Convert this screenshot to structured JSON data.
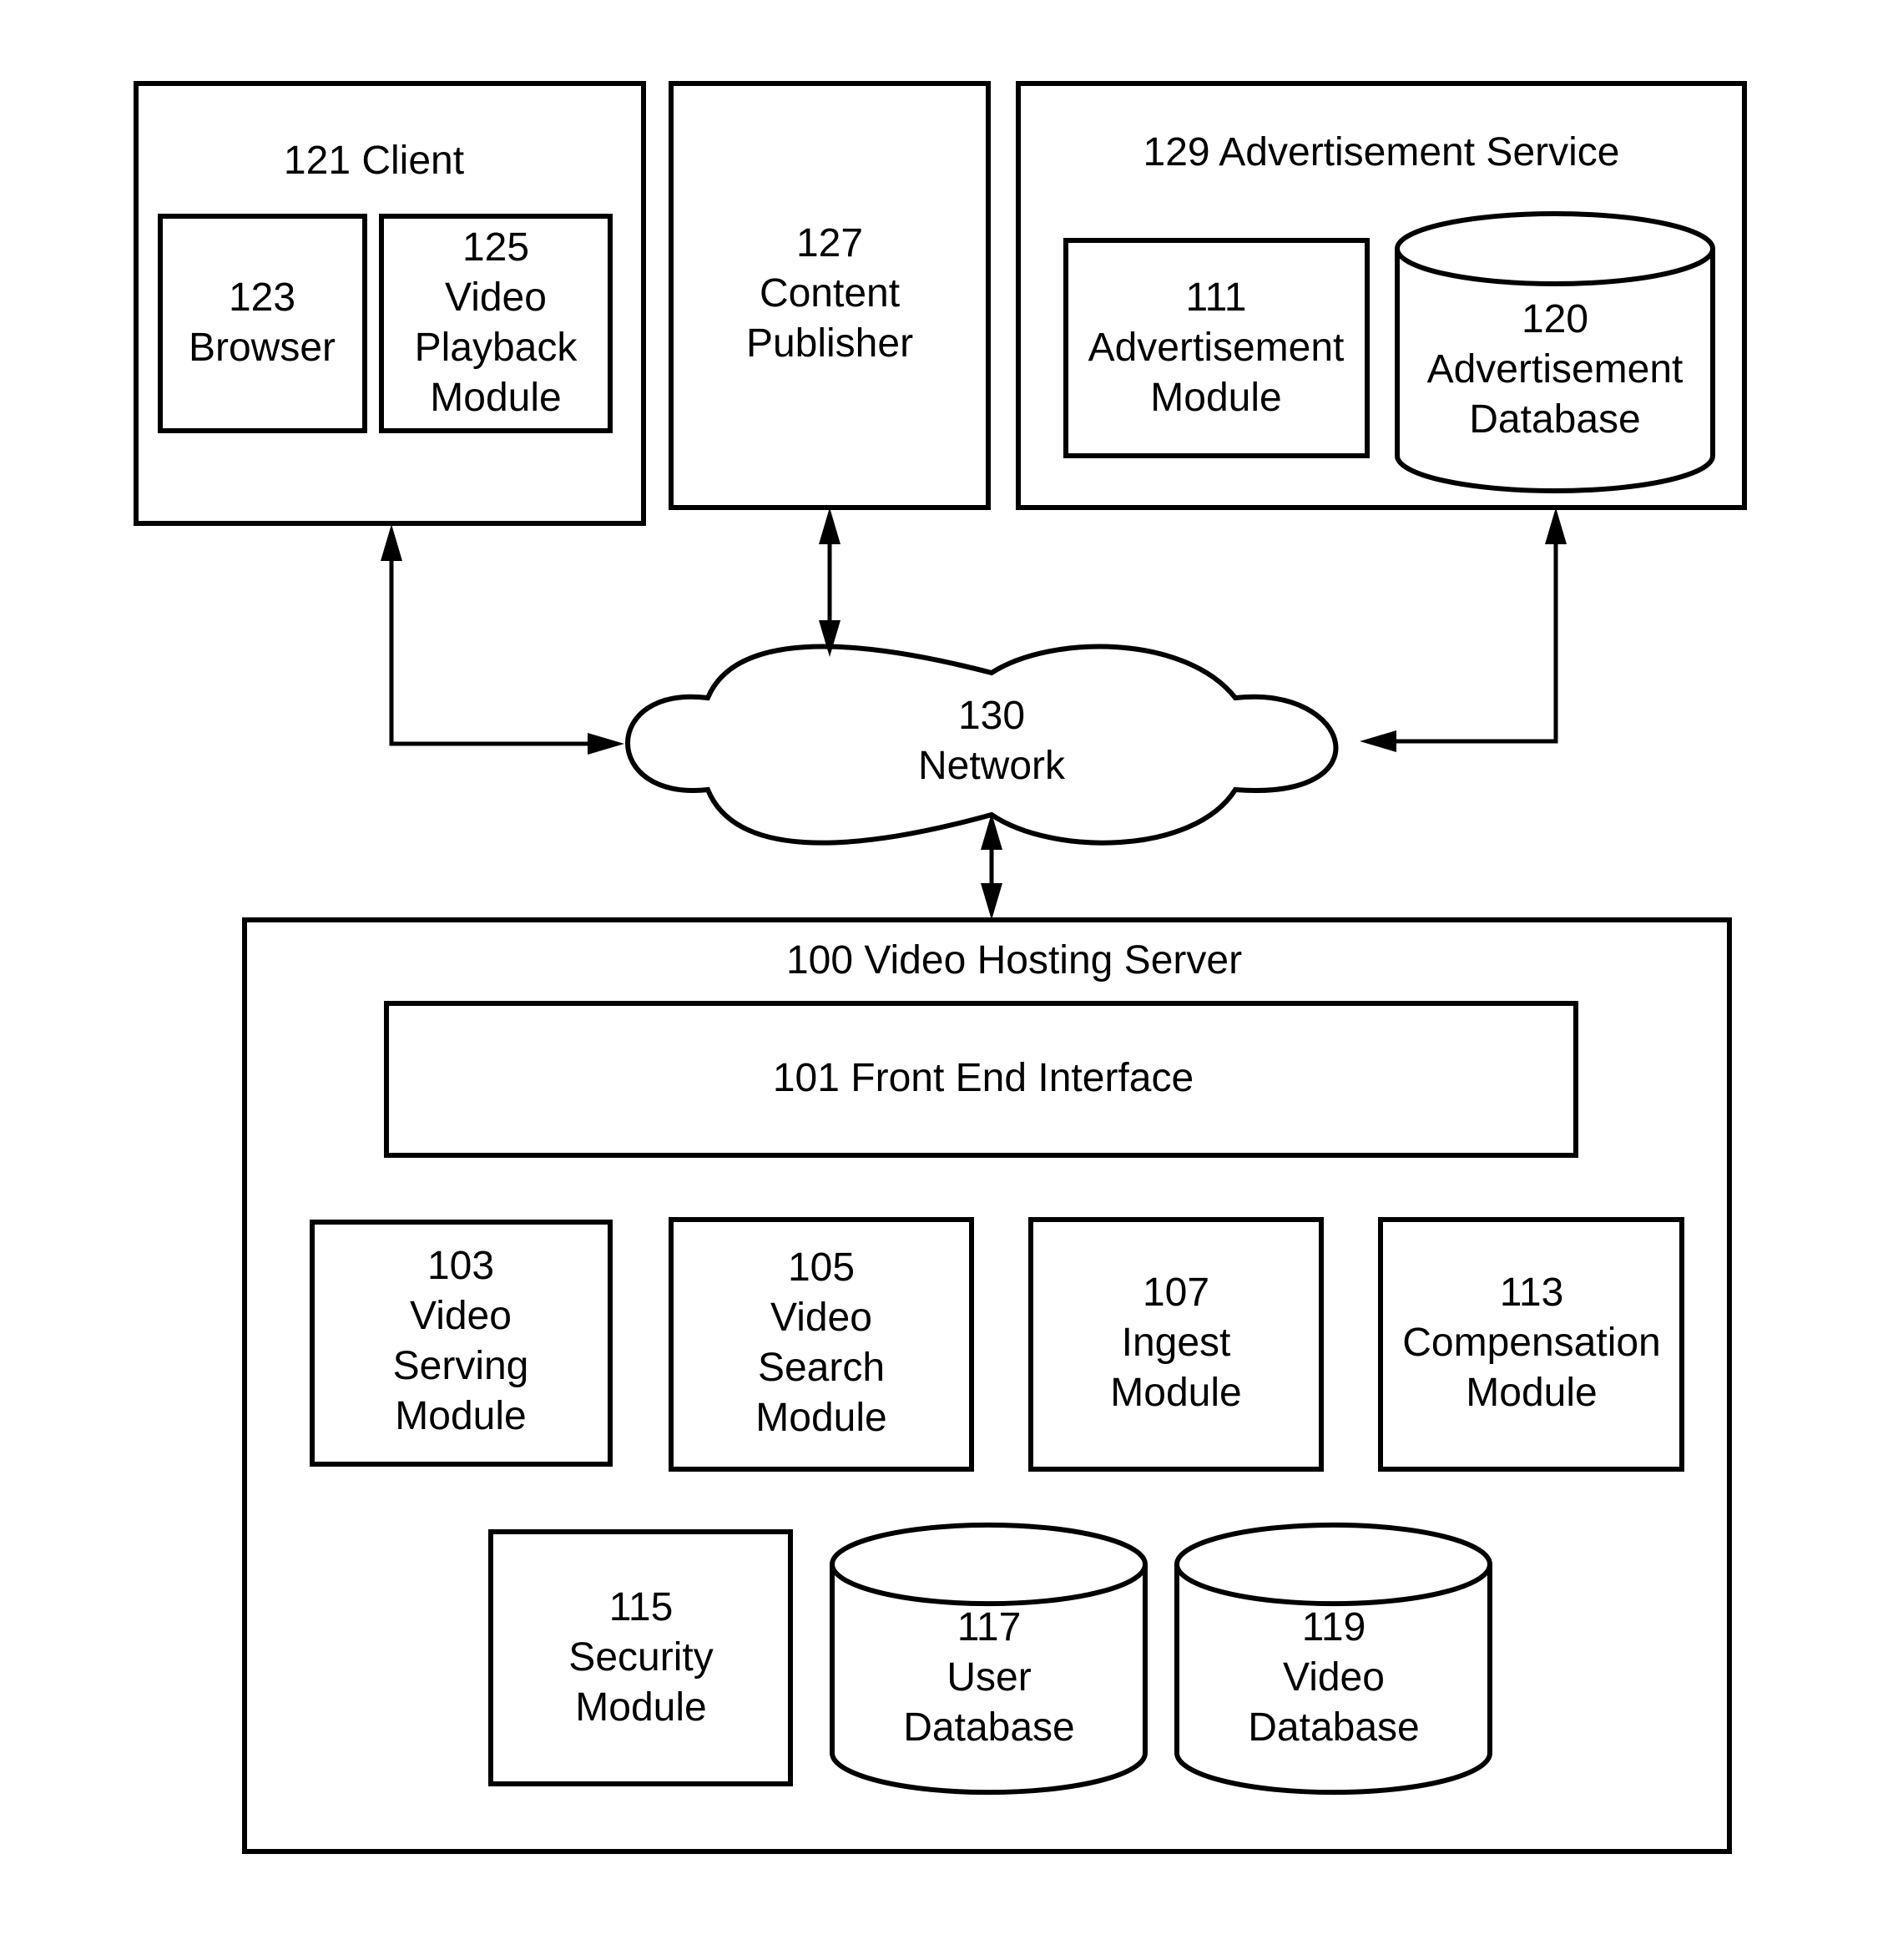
{
  "diagram": {
    "client": {
      "title": "121 Client",
      "browser": [
        "123",
        "Browser"
      ],
      "playback": [
        "125",
        "Video",
        "Playback",
        "Module"
      ]
    },
    "publisher": [
      "127",
      "Content",
      "Publisher"
    ],
    "ad_service": {
      "title": "129 Advertisement Service",
      "ad_module": [
        "111",
        "Advertisement",
        "Module"
      ],
      "ad_database": [
        "120",
        "Advertisement",
        "Database"
      ]
    },
    "network": [
      "130",
      "Network"
    ],
    "server": {
      "title": "100 Video Hosting Server",
      "front_end": "101 Front End Interface",
      "video_serving": [
        "103",
        "Video",
        "Serving",
        "Module"
      ],
      "video_search": [
        "105",
        "Video",
        "Search",
        "Module"
      ],
      "ingest": [
        "107",
        "Ingest",
        "Module"
      ],
      "compensation": [
        "113",
        "Compensation",
        "Module"
      ],
      "security": [
        "115",
        "Security",
        "Module"
      ],
      "user_db": [
        "117",
        "User",
        "Database"
      ],
      "video_db": [
        "119",
        "Video",
        "Database"
      ]
    }
  },
  "colors": {
    "stroke": "#000000",
    "background": "#ffffff"
  }
}
